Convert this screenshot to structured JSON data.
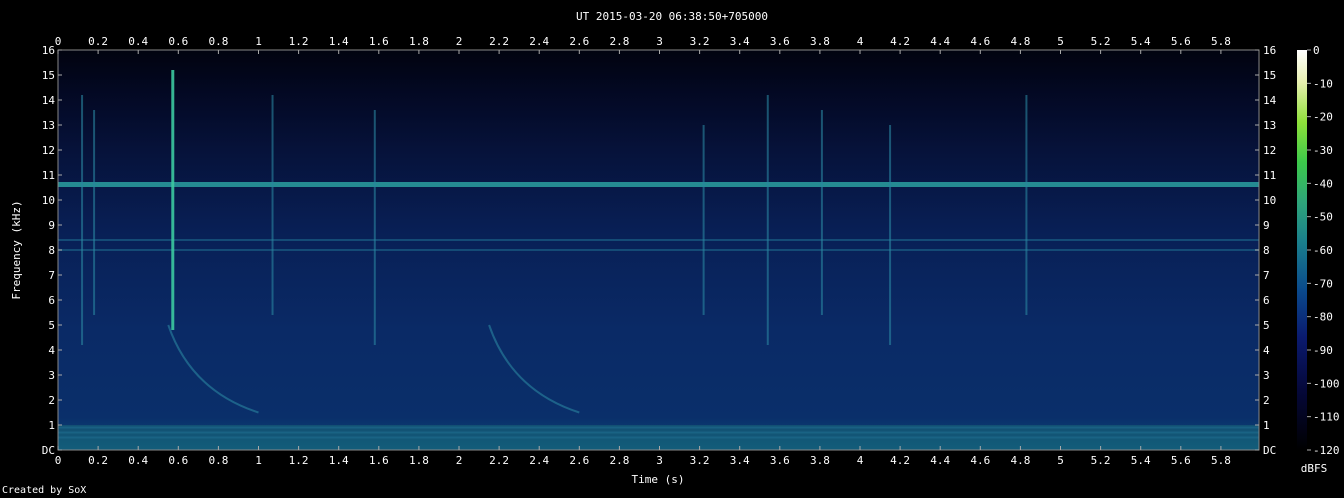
{
  "chart_data": {
    "type": "heatmap",
    "title": "UT 2015-03-20 06:38:50+705000",
    "xlabel": "Time (s)",
    "ylabel": "Frequency (kHz)",
    "xlim": [
      0,
      5.99
    ],
    "ylim": [
      0,
      16
    ],
    "x_ticks": [
      "0",
      "0.2",
      "0.4",
      "0.6",
      "0.8",
      "1",
      "1.2",
      "1.4",
      "1.6",
      "1.8",
      "2",
      "2.2",
      "2.4",
      "2.6",
      "2.8",
      "3",
      "3.2",
      "3.4",
      "3.6",
      "3.8",
      "4",
      "4.2",
      "4.4",
      "4.6",
      "4.8",
      "5",
      "5.2",
      "5.4",
      "5.6",
      "5.8"
    ],
    "x_tick_values": [
      0,
      0.2,
      0.4,
      0.6,
      0.8,
      1,
      1.2,
      1.4,
      1.6,
      1.8,
      2,
      2.2,
      2.4,
      2.6,
      2.8,
      3,
      3.2,
      3.4,
      3.6,
      3.8,
      4,
      4.2,
      4.4,
      4.6,
      4.8,
      5,
      5.2,
      5.4,
      5.6,
      5.8
    ],
    "y_ticks": [
      "DC",
      "1",
      "2",
      "3",
      "4",
      "5",
      "6",
      "7",
      "8",
      "9",
      "10",
      "11",
      "12",
      "13",
      "14",
      "15",
      "16"
    ],
    "y_tick_values": [
      0,
      1,
      2,
      3,
      4,
      5,
      6,
      7,
      8,
      9,
      10,
      11,
      12,
      13,
      14,
      15,
      16
    ],
    "colorbar": {
      "label": "dBFS",
      "ticks": [
        "0",
        "-10",
        "-20",
        "-30",
        "-40",
        "-50",
        "-60",
        "-70",
        "-80",
        "-90",
        "-100",
        "-110",
        "-120"
      ],
      "tick_values": [
        0,
        -10,
        -20,
        -30,
        -40,
        -50,
        -60,
        -70,
        -80,
        -90,
        -100,
        -110,
        -120
      ],
      "range": [
        -120,
        0
      ],
      "colors": [
        "#000000",
        "#05083a",
        "#0a1a6e",
        "#0a4a8c",
        "#1a7f8c",
        "#2ea57a",
        "#3cc94a",
        "#8fe03a",
        "#e8f0b0",
        "#ffffff"
      ]
    },
    "features": {
      "horizontal_lines_khz": [
        10.6,
        8.4,
        8.0,
        0.5,
        0.7,
        0.9
      ],
      "vertical_bursts_s": [
        0.12,
        0.18,
        0.57,
        1.07,
        1.58,
        3.22,
        3.54,
        3.81,
        4.15,
        4.83
      ],
      "descending_sweeps": [
        {
          "t_start": 0.55,
          "f_start": 5.0,
          "t_end": 1.0,
          "f_end": 1.5
        },
        {
          "t_start": 2.15,
          "f_start": 5.0,
          "t_end": 2.6,
          "f_end": 1.5
        }
      ]
    }
  },
  "footer": {
    "credit": "Created by SoX"
  }
}
